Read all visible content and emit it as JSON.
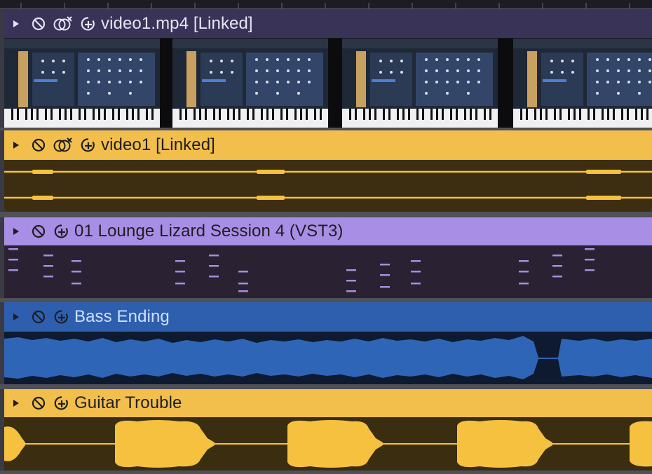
{
  "colors": {
    "video_header": "#3a3358",
    "video_text": "#e6e3f2",
    "video_link_header": "#f2bf4d",
    "video_link_body": "#3d2e12",
    "video_link_wave": "#f5c13f",
    "instrument_header": "#a98ee5",
    "instrument_body": "#2a2133",
    "instrument_notes": "#a58ee0",
    "bass_header": "#2e5fae",
    "bass_body": "#0e1a30",
    "bass_wave": "#2f65b6",
    "bass_text": "#cfe0ff",
    "guitar_header": "#f2bf4d",
    "guitar_body": "#3b2d10",
    "guitar_wave": "#f5c13f",
    "dark_text": "#1e1e22"
  },
  "tracks": [
    {
      "id": "video",
      "name": "video1.mp4 [Linked]",
      "controls": [
        "expand-arrow-icon",
        "mute-icon",
        "link-sync-icon",
        "record-arm-icon"
      ]
    },
    {
      "id": "video-audio",
      "name": "video1 [Linked]",
      "controls": [
        "expand-arrow-icon",
        "mute-icon",
        "link-sync-icon",
        "record-arm-icon"
      ]
    },
    {
      "id": "instrument",
      "name": "01 Lounge Lizard Session 4 (VST3)",
      "controls": [
        "expand-arrow-icon",
        "mute-icon",
        "record-arm-icon"
      ]
    },
    {
      "id": "bass",
      "name": "Bass Ending",
      "controls": [
        "expand-arrow-icon",
        "mute-icon",
        "record-arm-icon"
      ]
    },
    {
      "id": "guitar",
      "name": "Guitar Trouble",
      "controls": [
        "expand-arrow-icon",
        "mute-icon",
        "record-arm-icon"
      ]
    }
  ],
  "video_thumbnail_count": 4
}
